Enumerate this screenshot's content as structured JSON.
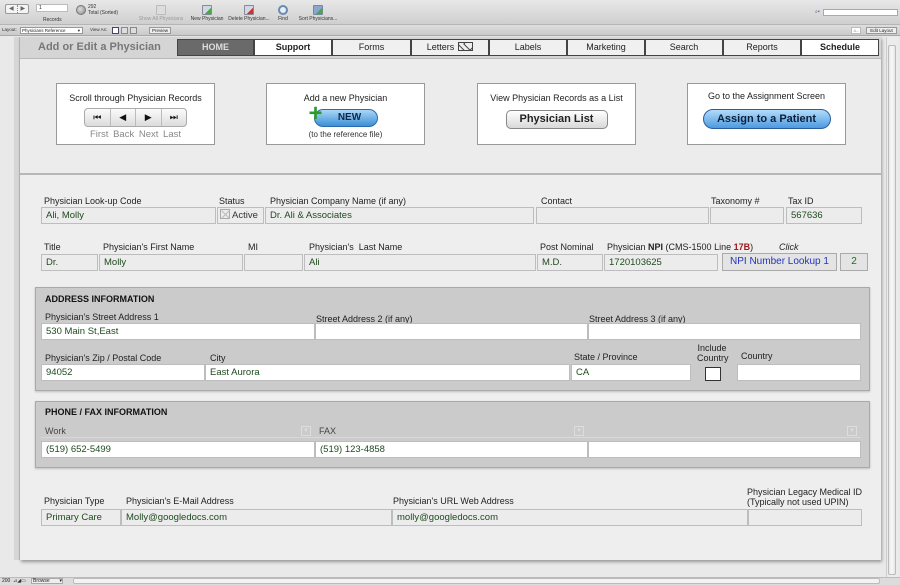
{
  "toolbar": {
    "record_current": "1",
    "records_label": "Records",
    "total_count": "292",
    "total_label": "Total (Sorted)",
    "buttons": [
      {
        "label": "Show All Physicians",
        "icon": "show-all-icon",
        "enabled": false
      },
      {
        "label": "New Physician",
        "icon": "new-record-icon",
        "enabled": true
      },
      {
        "label": "Delete Physician...",
        "icon": "delete-record-icon",
        "enabled": true
      },
      {
        "label": "Find",
        "icon": "find-icon",
        "enabled": true
      },
      {
        "label": "Sort Physicians...",
        "icon": "sort-icon",
        "enabled": true
      }
    ],
    "search_placeholder": ""
  },
  "layoutbar": {
    "layout_label": "Layout:",
    "layout_value": "Physicians Reference",
    "view_as_label": "View As:",
    "preview_label": "Preview",
    "aa_label": "A–",
    "edit_layout_label": "Edit Layout"
  },
  "header": {
    "title": "Add or Edit a Physician",
    "tabs": [
      {
        "label": "HOME",
        "active": true
      },
      {
        "label": "Support",
        "bold": true
      },
      {
        "label": "Forms"
      },
      {
        "label": "Letters",
        "icon": "envelope-icon"
      },
      {
        "label": "Labels"
      },
      {
        "label": "Marketing"
      },
      {
        "label": "Search"
      },
      {
        "label": "Reports"
      },
      {
        "label": "Schedule",
        "bold": true
      }
    ]
  },
  "actions": {
    "scroll": {
      "caption": "Scroll through Physician Records",
      "first": "First",
      "back": "Back",
      "next": "Next",
      "last": "Last"
    },
    "add_new": {
      "caption": "Add a new Physician",
      "button": "NEW",
      "subcaption": "(to the reference file)"
    },
    "list": {
      "caption": "View Physician Records as a List",
      "button": "Physician List"
    },
    "assign": {
      "caption": "Go to the Assignment Screen",
      "button": "Assign to a Patient"
    }
  },
  "form": {
    "lookup_code": {
      "label": "Physician Look-up Code",
      "value": "Ali, Molly"
    },
    "status": {
      "label": "Status",
      "value": "Active",
      "checked": false
    },
    "company": {
      "label": "Physician Company Name (if any)",
      "value": "Dr. Ali & Associates"
    },
    "contact": {
      "label": "Contact",
      "value": ""
    },
    "taxonomy": {
      "label": "Taxonomy #",
      "value": ""
    },
    "tax_id": {
      "label": "Tax ID",
      "value": "567636"
    },
    "title": {
      "label": "Title",
      "value": "Dr."
    },
    "first_name": {
      "label": "Physician's First Name",
      "value": "Molly"
    },
    "mi": {
      "label": "MI",
      "value": ""
    },
    "last_name": {
      "label": "Physician's  Last Name",
      "value": "Ali"
    },
    "post_nominal": {
      "label": "Post Nominal",
      "value": "M.D."
    },
    "npi": {
      "label_pre": "Physician ",
      "label_bold": "NPI",
      "label_mid": " (CMS-1500 Line ",
      "label_red": "17B",
      "label_post": ")",
      "value": "1720103625"
    },
    "click_label": "Click",
    "npi_lookup_1": "NPI Number Lookup 1",
    "npi_lookup_2": "2"
  },
  "address": {
    "heading": "ADDRESS INFORMATION",
    "street1": {
      "label": "Physician's Street Address 1",
      "value": "530 Main St,East"
    },
    "street2": {
      "label": "Street Address 2 (if any)",
      "value": ""
    },
    "street3": {
      "label": "Street Address 3 (if any)",
      "value": ""
    },
    "zip": {
      "label": "Physician's Zip / Postal Code",
      "value": "94052"
    },
    "city": {
      "label": "City",
      "value": "East Aurora"
    },
    "state": {
      "label": "State / Province",
      "value": "CA"
    },
    "include_country": {
      "label_line1": "Include",
      "label_line2": "Country",
      "checked": false
    },
    "country": {
      "label": "Country",
      "value": ""
    }
  },
  "phone": {
    "heading": "PHONE / FAX INFORMATION",
    "fields": [
      {
        "label": "Work",
        "value": "(519) 652-5499"
      },
      {
        "label": "FAX",
        "value": "(519) 123-4858"
      },
      {
        "label": "",
        "value": ""
      }
    ]
  },
  "other": {
    "type": {
      "label": "Physician Type",
      "value": "Primary Care"
    },
    "email": {
      "label": "Physician's E-Mail Address",
      "value": "Molly@googledocs.com"
    },
    "url": {
      "label": "Physician's URL Web Address",
      "value": "molly@googledocs.com"
    },
    "legacy": {
      "label_line1": "Physician Legacy Medical ID",
      "label_line2": "(Typically not used UPIN)",
      "value": ""
    }
  },
  "statusbar": {
    "zoom": "200",
    "mode": "Browse"
  }
}
